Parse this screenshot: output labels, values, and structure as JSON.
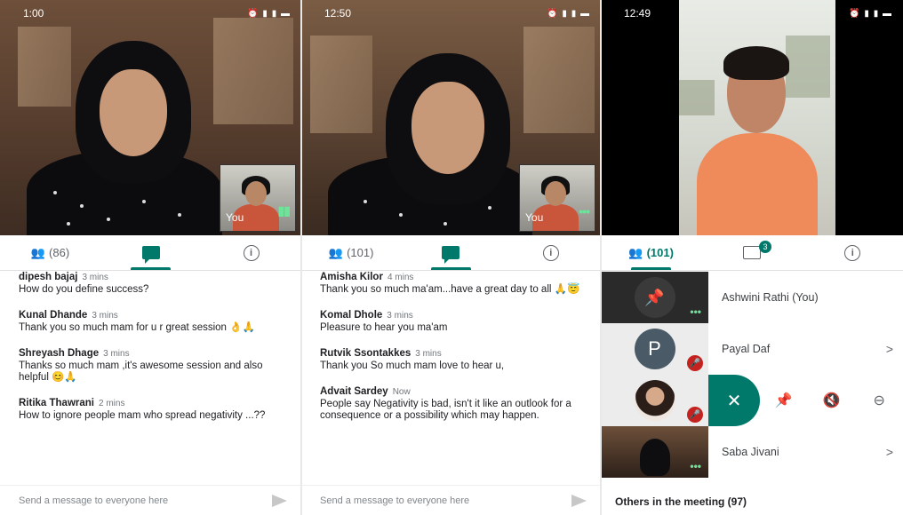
{
  "panels": [
    {
      "status": {
        "time": "1:00",
        "icons": "⏰ ▮ ▮ ▬"
      },
      "pip_label": "You",
      "tabs": {
        "people_count": "(86)"
      },
      "messages": [
        {
          "sender": "dipesh bajaj",
          "time": "3 mins",
          "text": "How do you define success?"
        },
        {
          "sender": "Kunal Dhande",
          "time": "3 mins",
          "text": "Thank you so much mam for u r great session 👌🙏"
        },
        {
          "sender": "Shreyash Dhage",
          "time": "3 mins",
          "text": "Thanks so much mam ,it's awesome session and also helpful 😊🙏"
        },
        {
          "sender": "Ritika Thawrani",
          "time": "2 mins",
          "text": "How to ignore people  mam who spread negativity ...??"
        }
      ],
      "composer_placeholder": "Send a message to everyone here"
    },
    {
      "status": {
        "time": "12:50",
        "icons": "⏰ ▮ ▮ ▬"
      },
      "pip_label": "You",
      "tabs": {
        "people_count": "(101)"
      },
      "messages": [
        {
          "sender": "Amisha Kilor",
          "time": "4 mins",
          "text": "Thank you so much ma'am...have a great day to all 🙏😇"
        },
        {
          "sender": "Komal Dhole",
          "time": "3 mins",
          "text": "Pleasure to hear you ma'am"
        },
        {
          "sender": "Rutvik Ssontakkes",
          "time": "3 mins",
          "text": "Thank you So much mam love to hear u,"
        },
        {
          "sender": "Advait Sardey",
          "time": "Now",
          "text": "People say Negativity is bad, isn't  it like an outlook for a consequence or a possibility which may happen."
        }
      ],
      "composer_placeholder": "Send a message to everyone here"
    },
    {
      "status": {
        "time": "12:49",
        "icons": "⏰ ▮ ▮ ▬"
      },
      "tabs": {
        "people_count": "(101)",
        "chat_badge": "3"
      },
      "participants": [
        {
          "name": "Ashwini Rathi (You)"
        },
        {
          "name": "Payal Daf",
          "avatar_letter": "P"
        },
        {
          "name": "Saba Jivani"
        }
      ],
      "others_label": "Others in the meeting (97)"
    }
  ],
  "colors": {
    "accent": "#00796b",
    "mute": "#c5221f"
  }
}
